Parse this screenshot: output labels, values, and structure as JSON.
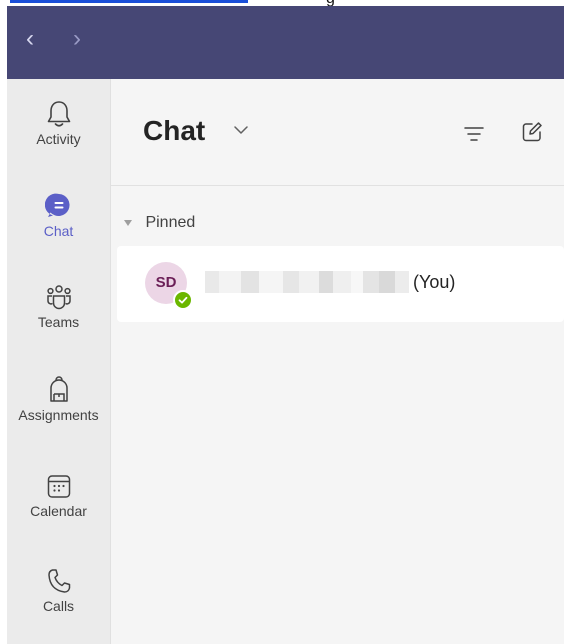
{
  "top_strip": {
    "glyph": "g"
  },
  "titlebar": {
    "back_glyph": "‹",
    "forward_glyph": "›",
    "color": "#464775"
  },
  "rail": {
    "items": [
      {
        "label": "Activity",
        "icon": "bell-icon"
      },
      {
        "label": "Chat",
        "icon": "chat-icon",
        "active": true
      },
      {
        "label": "Teams",
        "icon": "teams-icon"
      },
      {
        "label": "Assignments",
        "icon": "backpack-icon"
      },
      {
        "label": "Calendar",
        "icon": "calendar-icon"
      },
      {
        "label": "Calls",
        "icon": "phone-icon"
      }
    ]
  },
  "chat_header": {
    "title": "Chat",
    "filter_icon": "filter-icon",
    "compose_icon": "compose-icon"
  },
  "pinned": {
    "label": "Pinned"
  },
  "chat_list": [
    {
      "initials": "SD",
      "suffix": "(You)",
      "presence": "available",
      "name_redacted": true
    }
  ],
  "colors": {
    "accent": "#5b5fc7",
    "presence_available": "#6bb700",
    "avatar_bg": "#ecd6e6"
  }
}
